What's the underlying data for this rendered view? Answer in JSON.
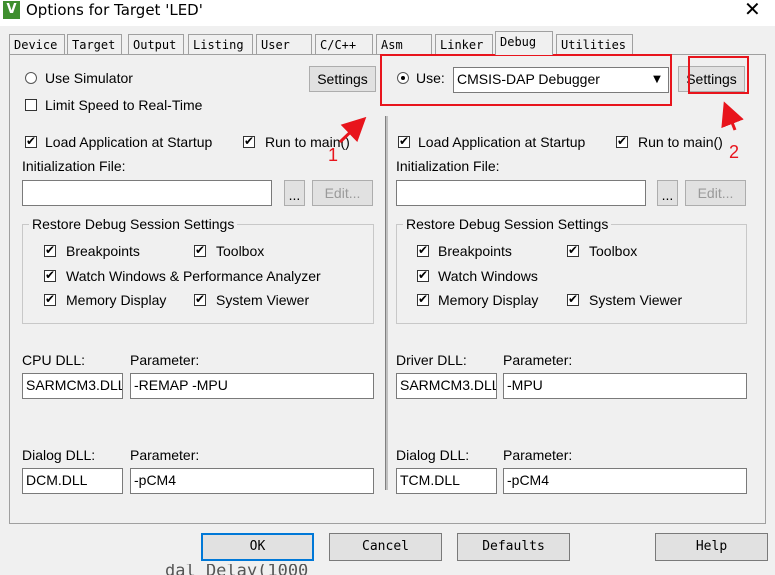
{
  "window": {
    "title": "Options for Target 'LED'",
    "app_icon": "V",
    "close_glyph": "✕"
  },
  "tabs": [
    "Device",
    "Target",
    "Output",
    "Listing",
    "User",
    "C/C++",
    "Asm",
    "Linker",
    "Debug",
    "Utilities"
  ],
  "active_tab": "Debug",
  "left": {
    "use_simulator_label": "Use Simulator",
    "use_simulator_selected": false,
    "settings_label": "Settings",
    "limit_speed_label": "Limit Speed to Real-Time",
    "limit_speed_checked": false,
    "load_app_label": "Load Application at Startup",
    "run_to_main_label": "Run to main()",
    "init_file_label": "Initialization File:",
    "init_file_value": "",
    "browse_label": "...",
    "edit_label": "Edit...",
    "restore_title": "Restore Debug Session Settings",
    "restore": {
      "breakpoints": "Breakpoints",
      "toolbox": "Toolbox",
      "watch": "Watch Windows & Performance Analyzer",
      "memory": "Memory Display",
      "sysviewer": "System Viewer"
    },
    "dll_label": "CPU DLL:",
    "dll_value": "SARMCM3.DLL",
    "dll_param_label": "Parameter:",
    "dll_param_value": "-REMAP -MPU",
    "dialog_dll_label": "Dialog DLL:",
    "dialog_dll_value": "DCM.DLL",
    "dialog_param_label": "Parameter:",
    "dialog_param_value": "-pCM4"
  },
  "right": {
    "use_label": "Use:",
    "use_selected": true,
    "debugger_value": "CMSIS-DAP Debugger",
    "settings_label": "Settings",
    "load_app_label": "Load Application at Startup",
    "run_to_main_label": "Run to main()",
    "init_file_label": "Initialization File:",
    "init_file_value": "",
    "browse_label": "...",
    "edit_label": "Edit...",
    "restore_title": "Restore Debug Session Settings",
    "restore": {
      "breakpoints": "Breakpoints",
      "toolbox": "Toolbox",
      "watch": "Watch Windows",
      "memory": "Memory Display",
      "sysviewer": "System Viewer"
    },
    "dll_label": "Driver DLL:",
    "dll_value": "SARMCM3.DLL",
    "dll_param_label": "Parameter:",
    "dll_param_value": "-MPU",
    "dialog_dll_label": "Dialog DLL:",
    "dialog_dll_value": "TCM.DLL",
    "dialog_param_label": "Parameter:",
    "dialog_param_value": "-pCM4"
  },
  "annotations": {
    "label_1": "1",
    "label_2": "2",
    "color": "#e8141c"
  },
  "buttons": {
    "ok": "OK",
    "cancel": "Cancel",
    "defaults": "Defaults",
    "help": "Help"
  },
  "background_text": "dal_Delay(1000"
}
